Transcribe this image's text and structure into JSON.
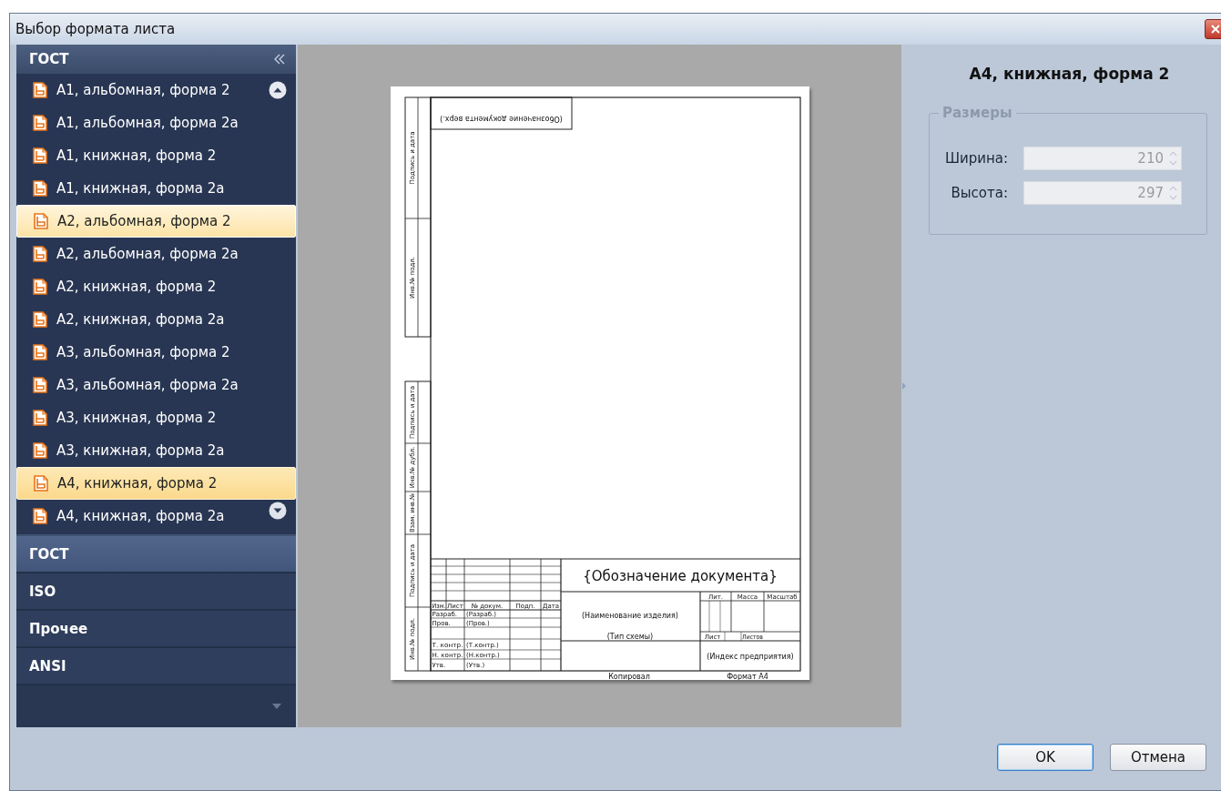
{
  "window": {
    "title": "Выбор формата листа"
  },
  "sidebar": {
    "header": "ГОСТ",
    "items": [
      {
        "label": "А1, альбомная, форма 2",
        "selected": false,
        "hovered": false
      },
      {
        "label": "А1, альбомная, форма 2а",
        "selected": false,
        "hovered": false
      },
      {
        "label": "А1, книжная, форма 2",
        "selected": false,
        "hovered": false
      },
      {
        "label": "А1, книжная, форма 2а",
        "selected": false,
        "hovered": false
      },
      {
        "label": "А2, альбомная, форма 2",
        "selected": false,
        "hovered": true
      },
      {
        "label": "А2, альбомная, форма 2а",
        "selected": false,
        "hovered": false
      },
      {
        "label": "А2, книжная, форма 2",
        "selected": false,
        "hovered": false
      },
      {
        "label": "А2, книжная, форма 2а",
        "selected": false,
        "hovered": false
      },
      {
        "label": "А3, альбомная, форма 2",
        "selected": false,
        "hovered": false
      },
      {
        "label": "А3, альбомная, форма 2а",
        "selected": false,
        "hovered": false
      },
      {
        "label": "А3, книжная, форма 2",
        "selected": false,
        "hovered": false
      },
      {
        "label": "А3, книжная, форма 2а",
        "selected": false,
        "hovered": false
      },
      {
        "label": "А4, книжная, форма 2",
        "selected": true,
        "hovered": false
      },
      {
        "label": "А4, книжная, форма 2а",
        "selected": false,
        "hovered": false
      }
    ],
    "groups": [
      {
        "label": "ГОСТ",
        "selected": true
      },
      {
        "label": "ISO",
        "selected": false
      },
      {
        "label": "Прочее",
        "selected": false
      },
      {
        "label": "ANSI",
        "selected": false
      }
    ]
  },
  "preview": {
    "sheet": {
      "top_stamp": "(Обозначение документа верх.)",
      "side_stamps_top": [
        "Подпись и дата",
        "Инв.№ подл."
      ],
      "side_stamps_bottom": [
        "Подпись и дата",
        "Инв.№ дубл.",
        "Взам. инв.№",
        "Подпись и дата",
        "Инв.№ подл."
      ],
      "designation": "{Обозначение документа}",
      "headers": [
        "Изм.",
        "Лист",
        "№ докум.",
        "Подп.",
        "Дата"
      ],
      "roles": [
        {
          "role": "Разраб.",
          "name": "(Разраб.)"
        },
        {
          "role": "Пров.",
          "name": "(Пров.)"
        },
        {
          "role": "Т. контр.",
          "name": "(Т.контр.)"
        },
        {
          "role": "Н. контр.",
          "name": "(Н.контр.)"
        },
        {
          "role": "Утв.",
          "name": "(Утв.)"
        }
      ],
      "product_name": "(Наименование изделия)",
      "schema_type": "(Тип схемы)",
      "info_headers": [
        "Лит.",
        "Масса",
        "Масштаб"
      ],
      "sheet_label": "Лист",
      "sheets_label": "Листов",
      "company": "(Индекс предприятия)",
      "copied": "Копировал",
      "format": "Формат А4"
    }
  },
  "details": {
    "title": "А4, книжная, форма 2",
    "group_label": "Размеры",
    "fields": [
      {
        "label": "Ширина:",
        "value": "210",
        "disabled": true
      },
      {
        "label": "Высота:",
        "value": "297",
        "disabled": true
      }
    ]
  },
  "buttons": [
    {
      "label": "OK",
      "default": true
    },
    {
      "label": "Отмена",
      "default": false
    }
  ]
}
